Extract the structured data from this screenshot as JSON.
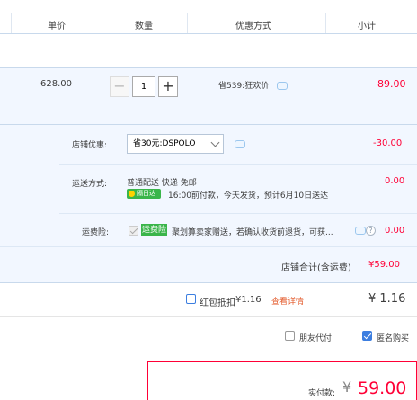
{
  "header": {
    "col_price": "单价",
    "col_qty": "数量",
    "col_promo": "优惠方式",
    "col_subtotal": "小计"
  },
  "item": {
    "unit_price": "628.00",
    "qty_minus": "−",
    "quantity": "1",
    "qty_plus": "+",
    "promo": "省539:狂欢价",
    "subtotal": "89.00"
  },
  "shop": {
    "discount_label": "店铺优惠:",
    "discount_select": "省30元:DSPOLO",
    "discount_amount": "-30.00",
    "shipping_label": "运送方式:",
    "shipping_method": "普通配送 快递 免邮",
    "shipping_badge": "隔日达",
    "shipping_note": "16:00前付款，今天发货，预计6月10日送达",
    "shipping_amount": "0.00",
    "insurance_label": "运费险:",
    "insurance_tag": "运费险",
    "insurance_text": "聚划算卖家赠送，若确认收货前退货，可获...",
    "insurance_amount": "0.00",
    "shop_total_label": "店铺合计(含运费)",
    "shop_total": "¥59.00"
  },
  "redpacket": {
    "label": "红包抵扣",
    "amount_inline": "¥1.16",
    "detail_link": "查看详情",
    "amount": "¥ 1.16"
  },
  "options": {
    "friend_pay": "朋友代付",
    "anonymous": "匿名购买",
    "friend_pay_checked": false,
    "anonymous_checked": true
  },
  "payment": {
    "label": "实付款:",
    "currency": "¥",
    "amount": "59.00"
  },
  "colors": {
    "accent_red": "#ff0036",
    "row_bg": "#f2f7ff",
    "badge_green": "#3ab54a",
    "checkbox_blue": "#3c7ee0"
  }
}
